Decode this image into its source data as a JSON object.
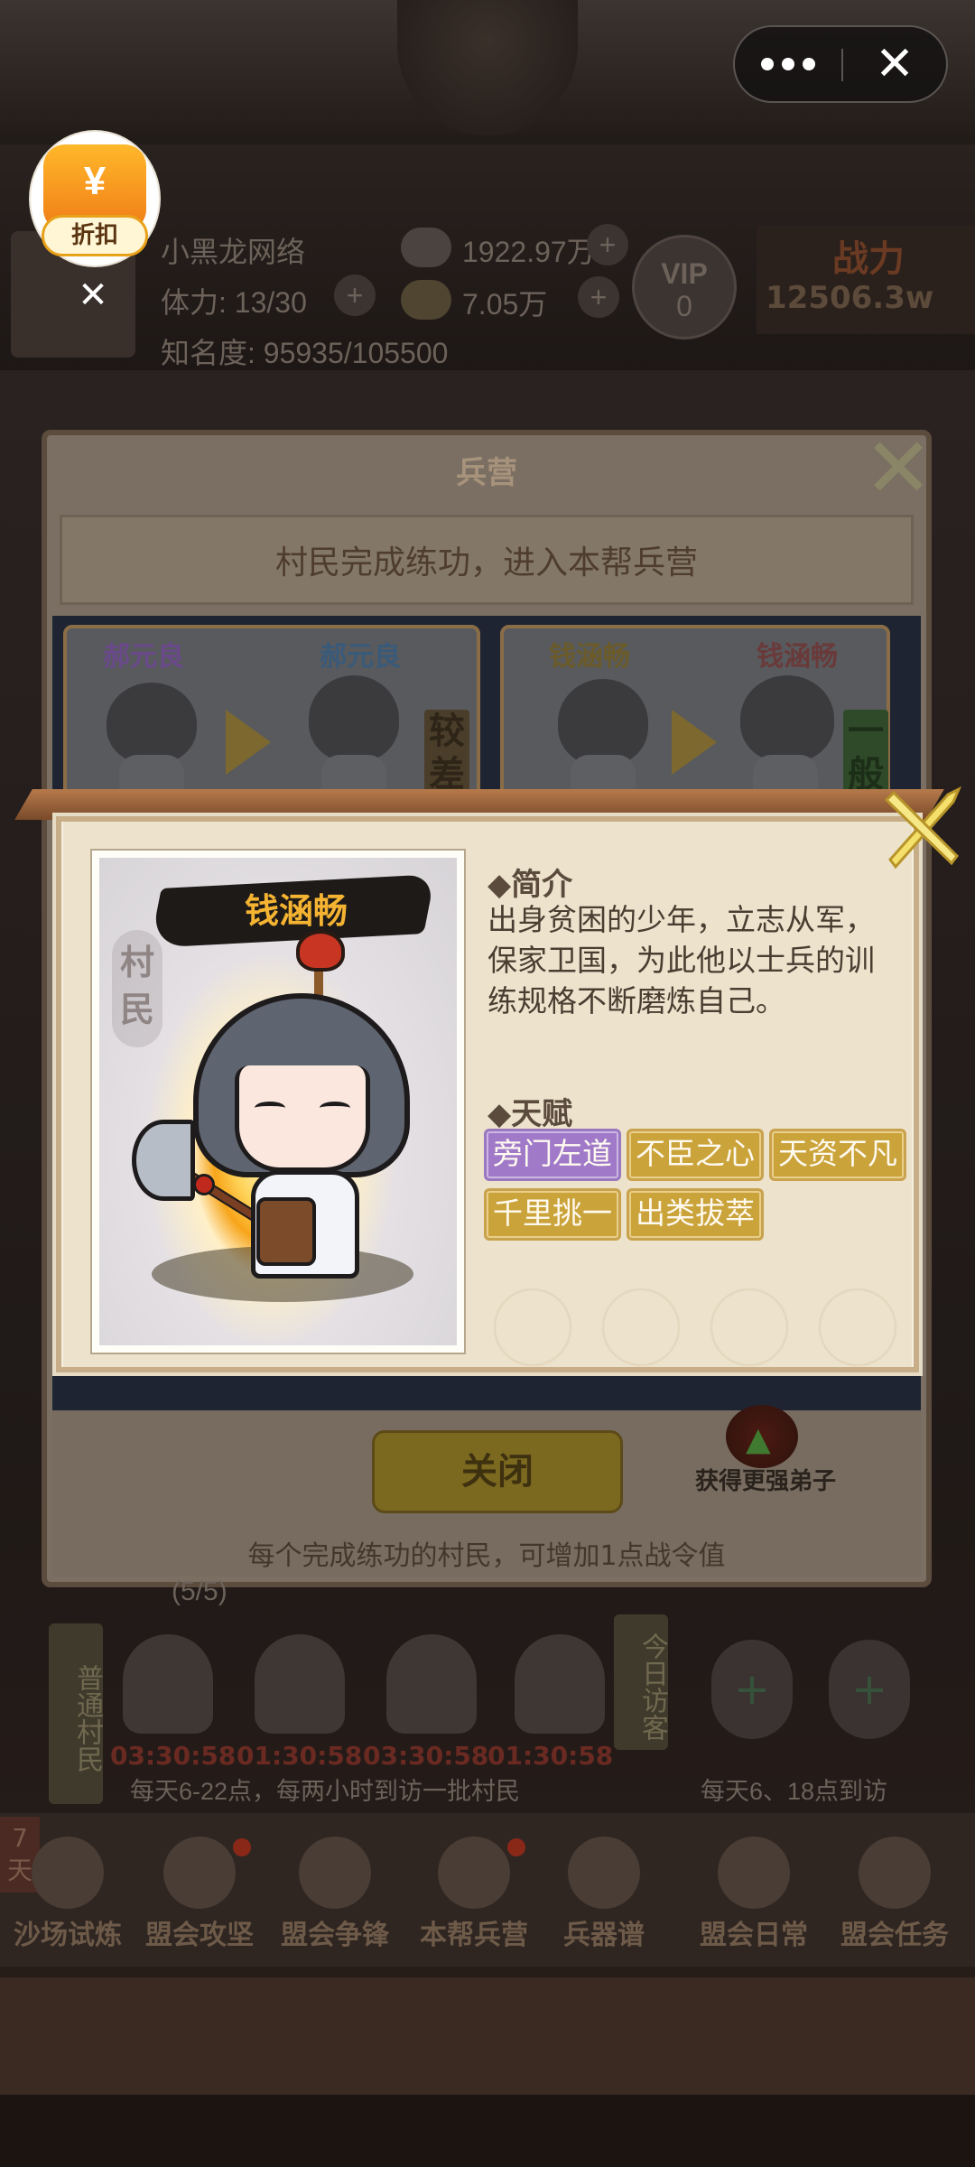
{
  "topbar": {
    "more_label": "•••",
    "close_label": "✕"
  },
  "discount_badge": {
    "symbol": "¥",
    "label": "折扣",
    "dismiss": "✕"
  },
  "header_stats": {
    "player_name": "小黑龙网络",
    "silver": "1922.97万",
    "stamina": "体力: 13/30",
    "gold": "7.05万",
    "fame": "知名度: 95935/105500",
    "vip_label": "VIP",
    "vip_level": "0",
    "power_label": "战力",
    "power_value": "12506.3w"
  },
  "barracks_panel": {
    "title": "兵营",
    "banner_text": "村民完成练功，进入本帮兵营",
    "cards": [
      {
        "from_name": "郝元良",
        "to_name": "郝元良",
        "grade": "较差"
      },
      {
        "from_name": "钱涵畅",
        "to_name": "钱涵畅",
        "grade": "一般"
      }
    ],
    "close_button": "关闭",
    "get_stronger": "获得更强弟子",
    "tip": "每个完成练功的村民，可增加1点战令值"
  },
  "roster": {
    "left_tag": "普通村民",
    "right_tag": "今日访客",
    "timers": [
      "03:30:58",
      "01:30:58",
      "03:30:58",
      "01:30:58"
    ],
    "visit_note": "每天6-22点，每两小时到访一批村民",
    "visit_note2": "每天6、18点到访",
    "counter": "(5/5)",
    "plus": "+"
  },
  "bottom_nav": {
    "days": "7天",
    "items": [
      "沙场试炼",
      "盟会攻坚",
      "盟会争锋",
      "本帮兵营",
      "兵器谱",
      "盟会日常",
      "盟会任务"
    ]
  },
  "detail_popup": {
    "character_name": "钱涵畅",
    "rank": "村民",
    "intro_title": "◆简介",
    "intro_text": "出身贫困的少年，立志从军，保家卫国，为此他以士兵的训练规格不断磨炼自己。",
    "talent_title": "◆天赋",
    "talents": [
      {
        "label": "旁门左道",
        "tier": "purple"
      },
      {
        "label": "不臣之心",
        "tier": "gold"
      },
      {
        "label": "天资不凡",
        "tier": "gold"
      },
      {
        "label": "千里挑一",
        "tier": "gold"
      },
      {
        "label": "出类拔萃",
        "tier": "gold"
      }
    ]
  },
  "colors": {
    "talent_gold": "#caa33a",
    "talent_purple": "#a07ac8",
    "name_orange": "#f5b332",
    "popup_bg": "#ede3cd"
  }
}
